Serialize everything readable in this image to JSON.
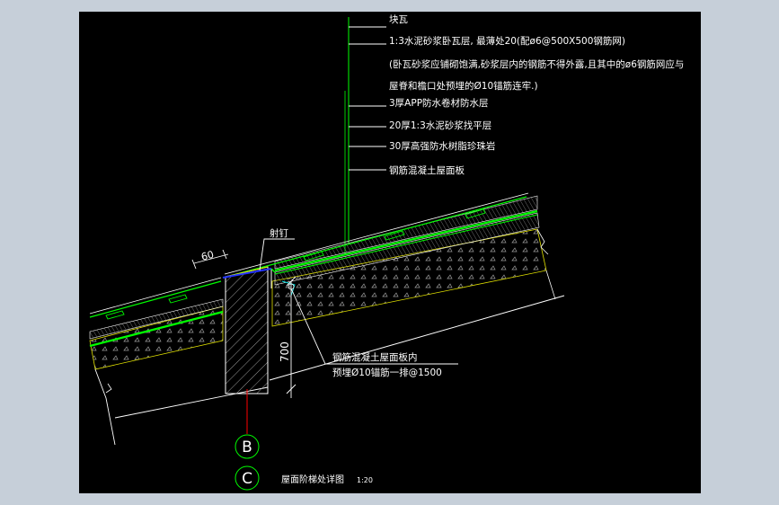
{
  "labels": {
    "l1": "块瓦",
    "l2": "1:3水泥砂浆卧瓦层, 最薄处20(配ø6@500X500钢筋网)",
    "l3a": "(卧瓦砂浆应铺砌饱满,砂浆层内的钢筋不得外露,且其中的ø6钢筋网应与",
    "l3b": "屋脊和檐口处预埋的Ø10锚筋连牢.)",
    "l4": "3厚APP防水卷材防水层",
    "l5": "20厚1:3水泥砂浆找平层",
    "l6": "30厚高强防水树脂珍珠岩",
    "l7": "钢筋混凝土屋面板"
  },
  "annotations": {
    "nail": "射钉",
    "dim60": "60",
    "dim700": "700",
    "anchor_a": "钢筋混凝土屋面板内",
    "anchor_b": "预埋Ø10锚筋一排@1500"
  },
  "axes": {
    "b": "B",
    "c": "C"
  },
  "title": {
    "text": "屋面阶梯处详图",
    "scale": "1:20"
  },
  "colors": {
    "background": "#000000",
    "frame": "#c6cfd9",
    "leader": "#00ff00",
    "layer_green": "#00ff00",
    "text": "#ffffff",
    "axis_line": "#ff0000",
    "hatch": "#b0b0b0",
    "tile_blue": "#2233ff",
    "yellow": "#e0e000",
    "cyan": "#00e0e0"
  }
}
